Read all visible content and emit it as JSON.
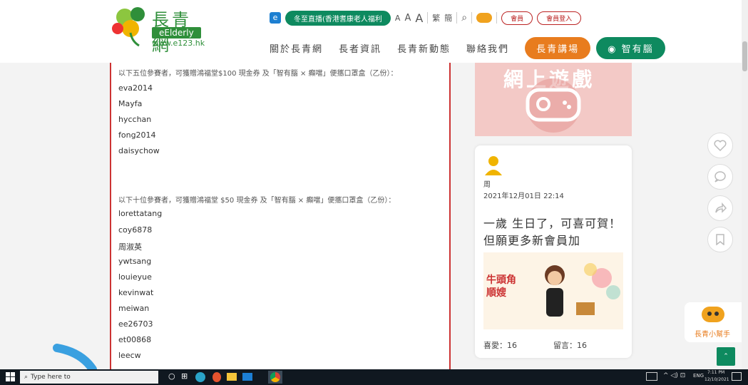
{
  "header": {
    "logo_text": "長青網",
    "logo_badge": "eElderly",
    "logo_url": "www.e123.hk",
    "live_label": "冬至直播(香港耆康老人福利",
    "font_sizes": [
      "A",
      "A",
      "A"
    ],
    "trad": "繁",
    "simp": "簡",
    "member_btn": "會員",
    "login_btn": "會員登入",
    "nav": [
      "關於長青網",
      "長者資訊",
      "長青新動態",
      "聯絡我們"
    ],
    "nav_orange": "長青講場",
    "nav_green": "智有腦"
  },
  "article": {
    "intro1": "以下五位參賽者，可獲贈鴻福堂$100 現金券 及「智有腦 × 癲噹」便攜口罩盒（乙份）：",
    "group1": [
      "eva2014",
      "Mayfa",
      "hycchan",
      "fong2014",
      "daisychow"
    ],
    "intro2": "以下十位參賽者，可獲贈鴻福堂 $50 現金券 及「智有腦 × 癲噹」便攜口罩盒（乙份）：",
    "group2": [
      "lorettatang",
      "coy6878",
      "周淑英",
      "ywtsang",
      "louieyue",
      "kevinwat",
      "meiwan",
      "ee26703",
      "et00868",
      "leecw"
    ]
  },
  "sidebar": {
    "banner_text": "網上遊戲",
    "card": {
      "author": "周",
      "datetime": "2021年12月01日 22:14",
      "text": "一歲 生日了，可喜可賀！但願更多新會員加",
      "image_text": "牛頭角順嫂",
      "likes_label": "喜愛：16",
      "comments_label": "留言：16"
    }
  },
  "helper": {
    "label": "長青小幫手"
  },
  "taskbar": {
    "search_placeholder": "Type here to",
    "lang": "ENG",
    "time": "7:11 PM",
    "date": "12/10/2021"
  },
  "colors": {
    "green": "#0e8a5f",
    "orange": "#e87c1e",
    "red_border": "#c33"
  }
}
